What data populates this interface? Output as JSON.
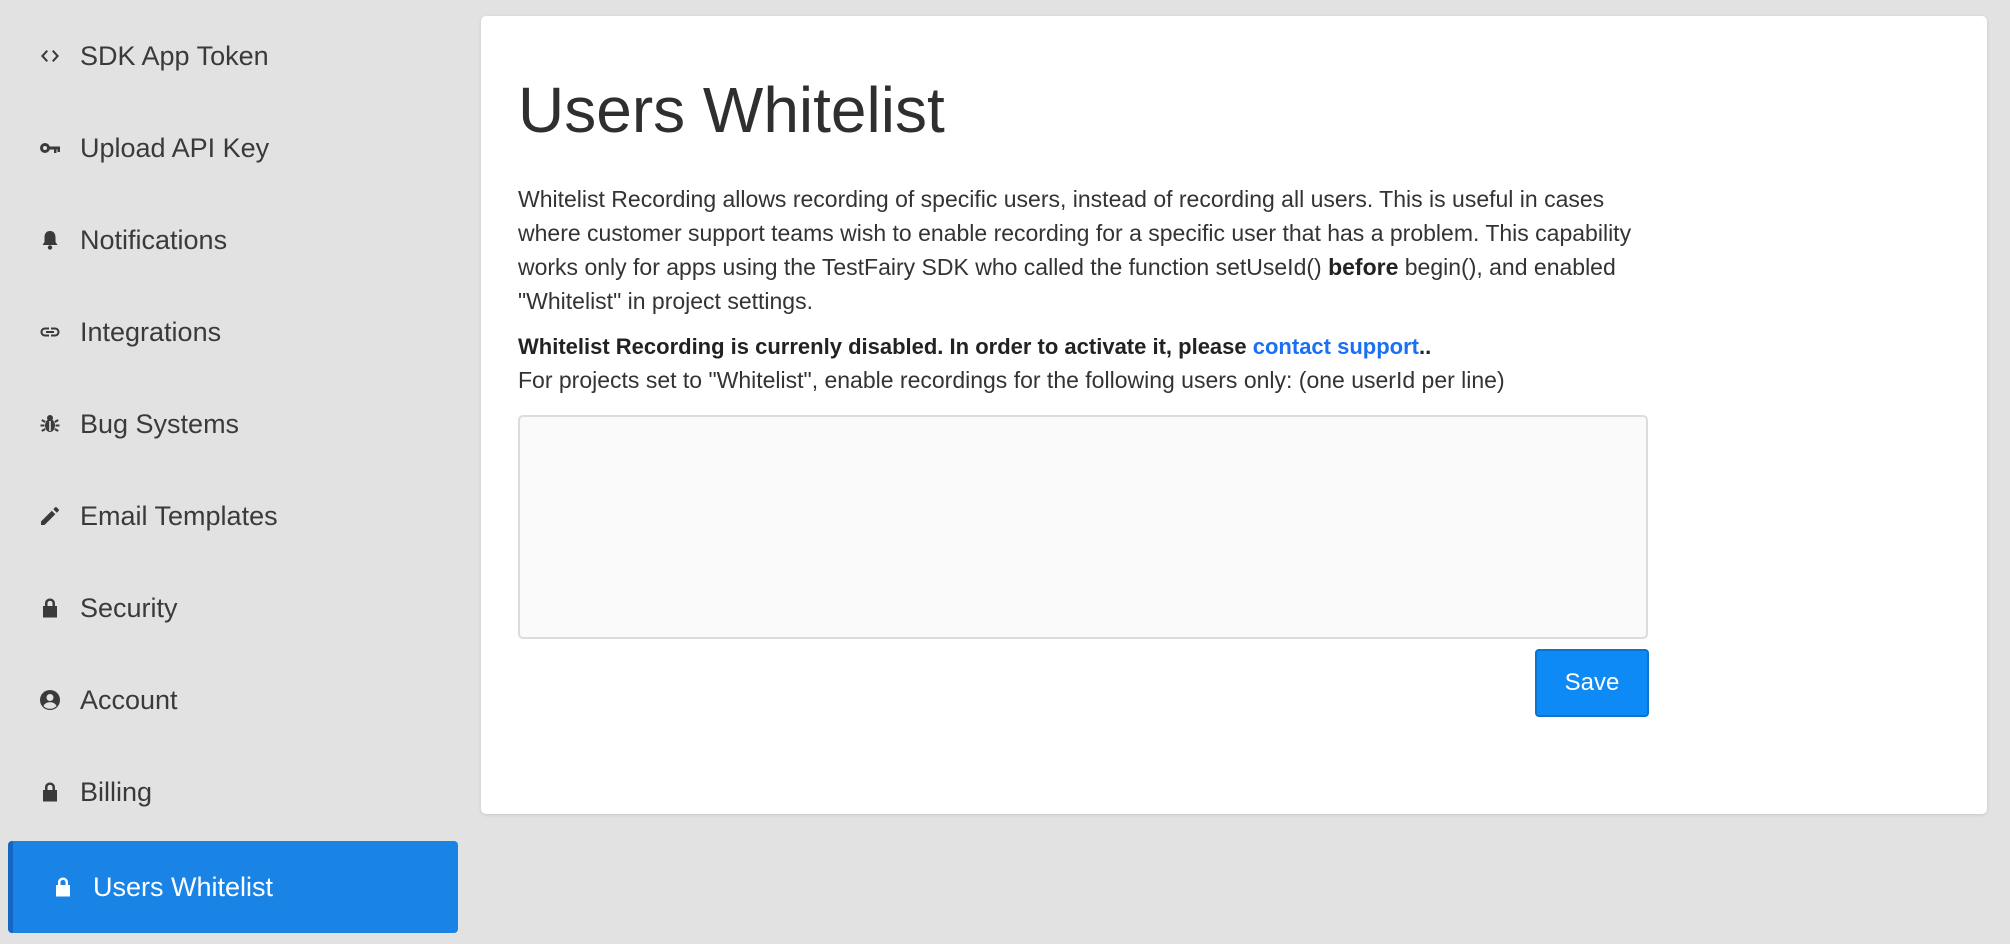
{
  "sidebar": {
    "items": [
      {
        "label": "SDK App Token",
        "icon": "code-icon"
      },
      {
        "label": "Upload API Key",
        "icon": "key-icon"
      },
      {
        "label": "Notifications",
        "icon": "bell-icon"
      },
      {
        "label": "Integrations",
        "icon": "link-icon"
      },
      {
        "label": "Bug Systems",
        "icon": "bug-icon"
      },
      {
        "label": "Email Templates",
        "icon": "pencil-icon"
      },
      {
        "label": "Security",
        "icon": "lock-icon"
      },
      {
        "label": "Account",
        "icon": "user-circle-icon"
      },
      {
        "label": "Billing",
        "icon": "lock-icon"
      },
      {
        "label": "Users Whitelist",
        "icon": "lock-icon",
        "active": true
      }
    ]
  },
  "main": {
    "title": "Users Whitelist",
    "description": {
      "text_before_bold": "Whitelist Recording allows recording of specific users, instead of recording all users. This is useful in cases where customer support teams wish to enable recording for a specific user that has a problem. This capability works only for apps using the TestFairy SDK who called the function setUseId() ",
      "bold": "before",
      "text_after_bold": " begin(), and enabled \"Whitelist\" in project settings."
    },
    "status": {
      "text": "Whitelist Recording is currenly disabled. In order to activate it, please ",
      "link_label": "contact support",
      "suffix": ".."
    },
    "instruction": "For projects set to \"Whitelist\", enable recordings for the following users only: (one userId per line)",
    "textarea_value": "",
    "save_label": "Save"
  },
  "colors": {
    "active_item_bg": "#1a83e6",
    "button_bg": "#0d8af5",
    "link": "#1a6ff2",
    "page_bg": "#e2e2e2"
  }
}
